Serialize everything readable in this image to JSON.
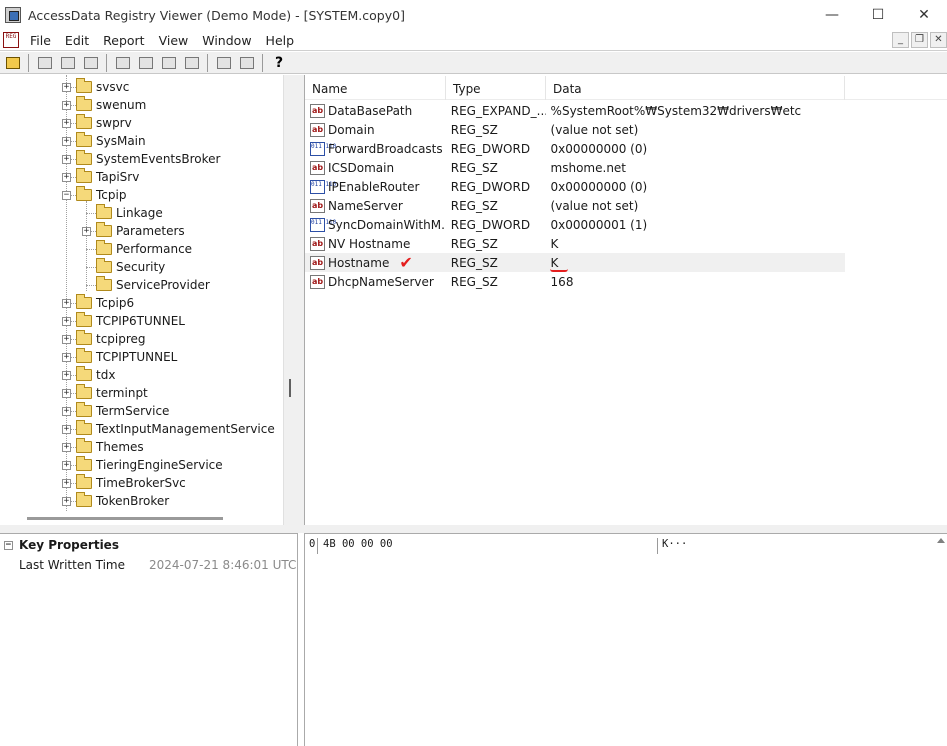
{
  "window": {
    "title": "AccessData Registry Viewer (Demo Mode) - [SYSTEM.copy0]",
    "minimize": "—",
    "maximize": "☐",
    "close": "✕"
  },
  "menu": {
    "items": [
      "File",
      "Edit",
      "Report",
      "View",
      "Window",
      "Help"
    ],
    "mdi_min": "_",
    "mdi_restore": "❐",
    "mdi_close": "✕",
    "doc_icon_text": "REG"
  },
  "toolbar": {
    "help_glyph": "?"
  },
  "tree": {
    "nodes": [
      {
        "label": "svsvc",
        "level": 0,
        "expander": "+"
      },
      {
        "label": "swenum",
        "level": 0,
        "expander": "+"
      },
      {
        "label": "swprv",
        "level": 0,
        "expander": "+"
      },
      {
        "label": "SysMain",
        "level": 0,
        "expander": "+"
      },
      {
        "label": "SystemEventsBroker",
        "level": 0,
        "expander": "+"
      },
      {
        "label": "TapiSrv",
        "level": 0,
        "expander": "+"
      },
      {
        "label": "Tcpip",
        "level": 0,
        "expander": "−"
      },
      {
        "label": "Linkage",
        "level": 1,
        "expander": ""
      },
      {
        "label": "Parameters",
        "level": 1,
        "expander": "+"
      },
      {
        "label": "Performance",
        "level": 1,
        "expander": ""
      },
      {
        "label": "Security",
        "level": 1,
        "expander": ""
      },
      {
        "label": "ServiceProvider",
        "level": 1,
        "expander": ""
      },
      {
        "label": "Tcpip6",
        "level": 0,
        "expander": "+"
      },
      {
        "label": "TCPIP6TUNNEL",
        "level": 0,
        "expander": "+"
      },
      {
        "label": "tcpipreg",
        "level": 0,
        "expander": "+"
      },
      {
        "label": "TCPIPTUNNEL",
        "level": 0,
        "expander": "+"
      },
      {
        "label": "tdx",
        "level": 0,
        "expander": "+"
      },
      {
        "label": "terminpt",
        "level": 0,
        "expander": "+"
      },
      {
        "label": "TermService",
        "level": 0,
        "expander": "+"
      },
      {
        "label": "TextInputManagementService",
        "level": 0,
        "expander": "+"
      },
      {
        "label": "Themes",
        "level": 0,
        "expander": "+"
      },
      {
        "label": "TieringEngineService",
        "level": 0,
        "expander": "+"
      },
      {
        "label": "TimeBrokerSvc",
        "level": 0,
        "expander": "+"
      },
      {
        "label": "TokenBroker",
        "level": 0,
        "expander": "+"
      }
    ]
  },
  "values": {
    "columns": [
      "Name",
      "Type",
      "Data"
    ],
    "rows": [
      {
        "icon": "ab",
        "name": "DataBasePath",
        "type": "REG_EXPAND_...",
        "data": "%SystemRoot%₩System32₩drivers₩etc"
      },
      {
        "icon": "ab",
        "name": "Domain",
        "type": "REG_SZ",
        "data": "(value not set)"
      },
      {
        "icon": "bin",
        "name": "ForwardBroadcasts",
        "type": "REG_DWORD",
        "data": "0x00000000 (0)"
      },
      {
        "icon": "ab",
        "name": "ICSDomain",
        "type": "REG_SZ",
        "data": "mshome.net"
      },
      {
        "icon": "bin",
        "name": "IPEnableRouter",
        "type": "REG_DWORD",
        "data": "0x00000000 (0)"
      },
      {
        "icon": "ab",
        "name": "NameServer",
        "type": "REG_SZ",
        "data": "(value not set)"
      },
      {
        "icon": "bin",
        "name": "SyncDomainWithM...",
        "type": "REG_DWORD",
        "data": "0x00000001 (1)"
      },
      {
        "icon": "ab",
        "name": "NV Hostname",
        "type": "REG_SZ",
        "data": "K"
      },
      {
        "icon": "ab",
        "name": "Hostname",
        "type": "REG_SZ",
        "data": "K",
        "selected": true
      },
      {
        "icon": "ab",
        "name": "DhcpNameServer",
        "type": "REG_SZ",
        "data": "168"
      }
    ],
    "check_glyph": "✔",
    "icon_ab_text": "ab",
    "icon_bin_text": "011 110"
  },
  "properties": {
    "header": "Key Properties",
    "expander": "−",
    "key": "Last Written Time",
    "value": "2024-07-21  8:46:01 UTC"
  },
  "hex": {
    "offset": "0",
    "bytes": "4B 00 00 00",
    "ascii": "K···"
  }
}
